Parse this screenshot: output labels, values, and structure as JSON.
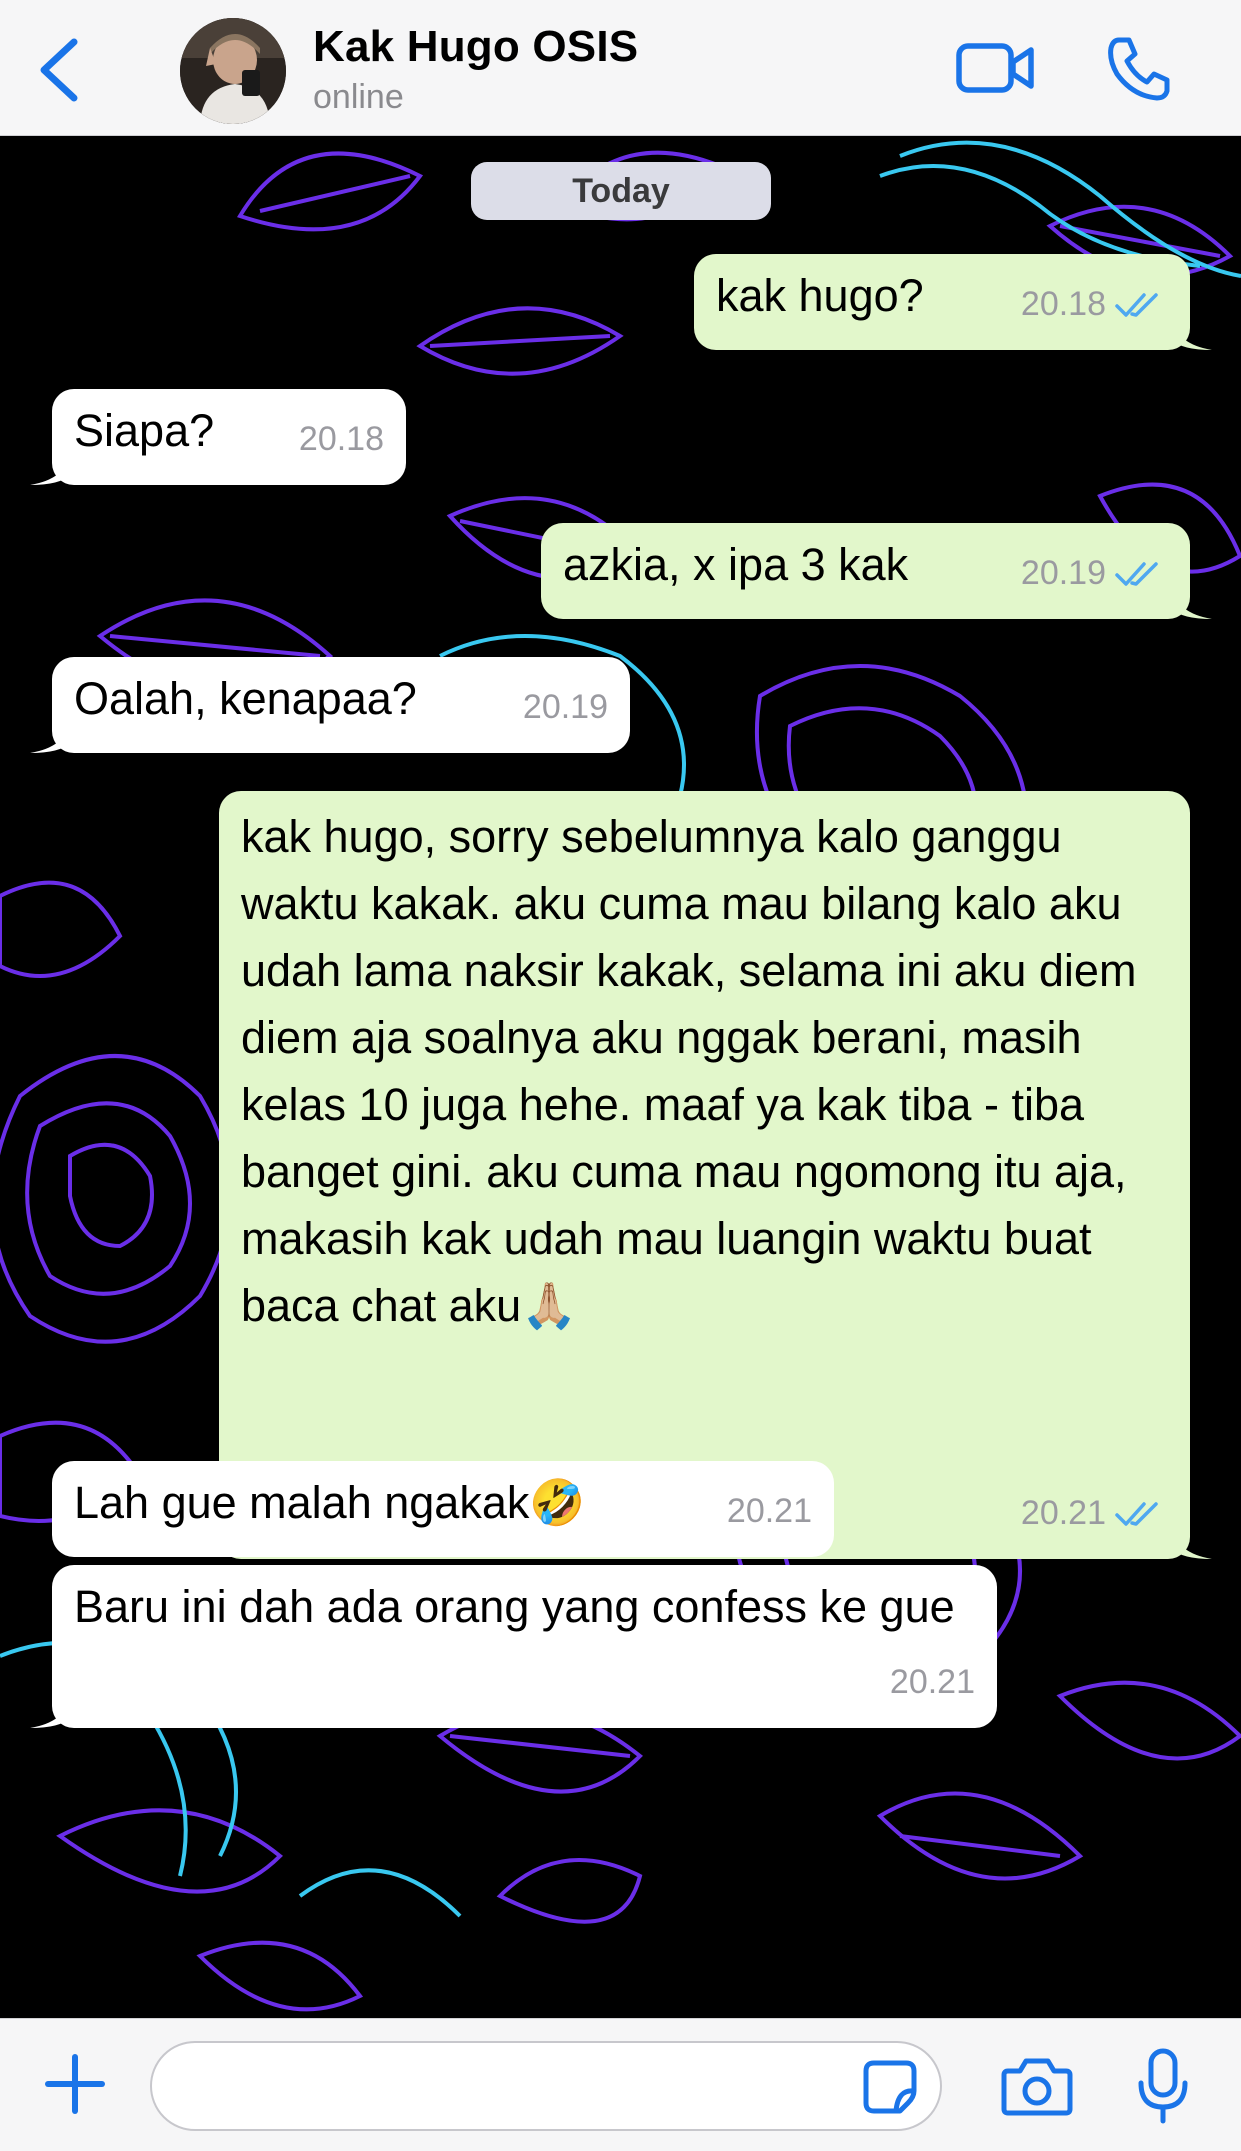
{
  "header": {
    "contact_name": "Kak Hugo OSIS",
    "status": "online",
    "icons": {
      "back": "chevron-left-icon",
      "video": "video-camera-icon",
      "call": "phone-icon"
    },
    "accent_color": "#1a74e8"
  },
  "chat": {
    "date_label": "Today",
    "messages": [
      {
        "direction": "out",
        "text": "kak hugo?",
        "time": "20.18",
        "status": "read"
      },
      {
        "direction": "in",
        "text": "Siapa?",
        "time": "20.18"
      },
      {
        "direction": "out",
        "text": "azkia, x ipa 3 kak",
        "time": "20.19",
        "status": "read"
      },
      {
        "direction": "in",
        "text": "Oalah, kenapaa?",
        "time": "20.19"
      },
      {
        "direction": "out",
        "text": "kak hugo, sorry sebelumnya kalo ganggu waktu kakak. aku cuma mau bilang kalo aku udah lama naksir kakak, selama ini aku diem diem aja soalnya aku nggak berani, masih kelas 10 juga hehe. maaf ya kak tiba - tiba banget gini. aku cuma mau ngomong itu aja, makasih kak udah mau luangin waktu buat baca chat aku🙏🏼",
        "time": "20.21",
        "status": "read"
      },
      {
        "direction": "in",
        "text": "Lah gue malah ngakak🤣",
        "time": "20.21"
      },
      {
        "direction": "in",
        "text": "Baru ini dah ada orang yang confess ke gue",
        "time": "20.21"
      }
    ],
    "colors": {
      "outgoing_bubble": "#e2f7cb",
      "incoming_bubble": "#ffffff",
      "read_ticks": "#4fa8f0",
      "wallpaper_bg": "#000000",
      "wallpaper_purple": "#6a2ee8",
      "wallpaper_cyan": "#39c8f0"
    }
  },
  "input_bar": {
    "placeholder": "",
    "icons": {
      "attach": "plus-icon",
      "sticker": "sticker-icon",
      "camera": "camera-icon",
      "mic": "microphone-icon"
    }
  }
}
